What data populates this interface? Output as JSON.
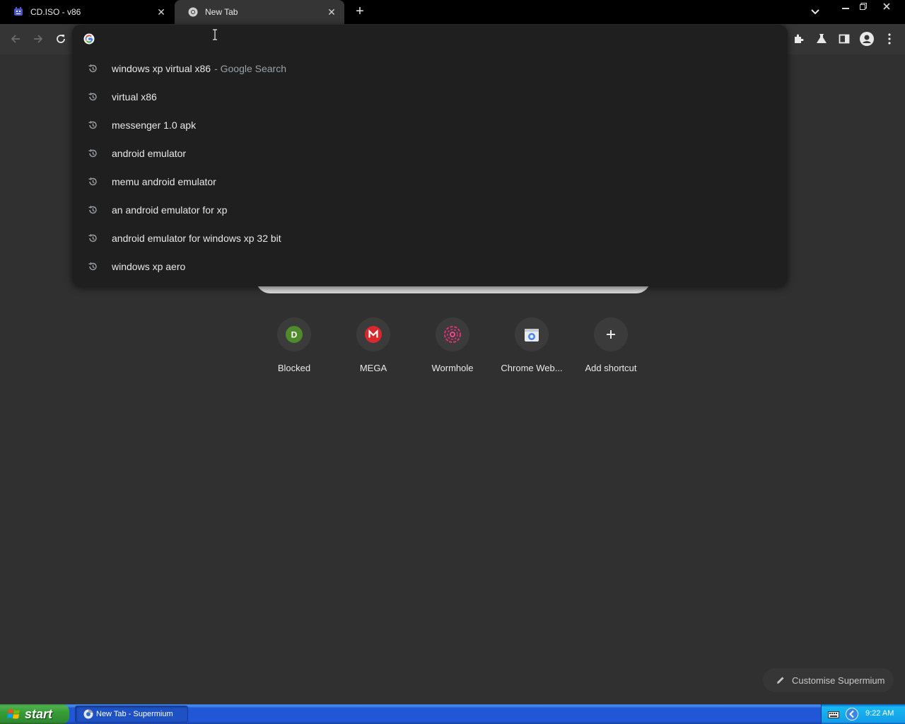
{
  "tabs": [
    {
      "title": "CD.ISO - v86",
      "active": false
    },
    {
      "title": "New Tab",
      "active": true
    }
  ],
  "omnibox": {
    "value": "",
    "placeholder": ""
  },
  "suggestions": [
    {
      "text": "windows xp virtual x86",
      "suffix": "- Google Search"
    },
    {
      "text": "virtual x86",
      "suffix": ""
    },
    {
      "text": "messenger 1.0 apk",
      "suffix": ""
    },
    {
      "text": "android emulator",
      "suffix": ""
    },
    {
      "text": "memu android emulator",
      "suffix": ""
    },
    {
      "text": "an android emulator for xp",
      "suffix": ""
    },
    {
      "text": "android emulator for windows xp 32 bit",
      "suffix": ""
    },
    {
      "text": "windows xp aero",
      "suffix": ""
    }
  ],
  "shortcuts": [
    {
      "label": "Blocked",
      "letter": "D",
      "color": "#4f8a2c"
    },
    {
      "label": "MEGA",
      "letter": "M",
      "color": "#d9272e"
    },
    {
      "label": "Wormhole",
      "letter": "",
      "color": "#e0336f"
    },
    {
      "label": "Chrome Web...",
      "letter": "",
      "color": "#4285f4"
    },
    {
      "label": "Add shortcut",
      "letter": "+",
      "color": "#e8e8e8"
    }
  ],
  "customise_label": "Customise Supermium",
  "taskbar": {
    "start_label": "start",
    "task_label": "New Tab - Supermium",
    "clock": "9:22 AM"
  }
}
